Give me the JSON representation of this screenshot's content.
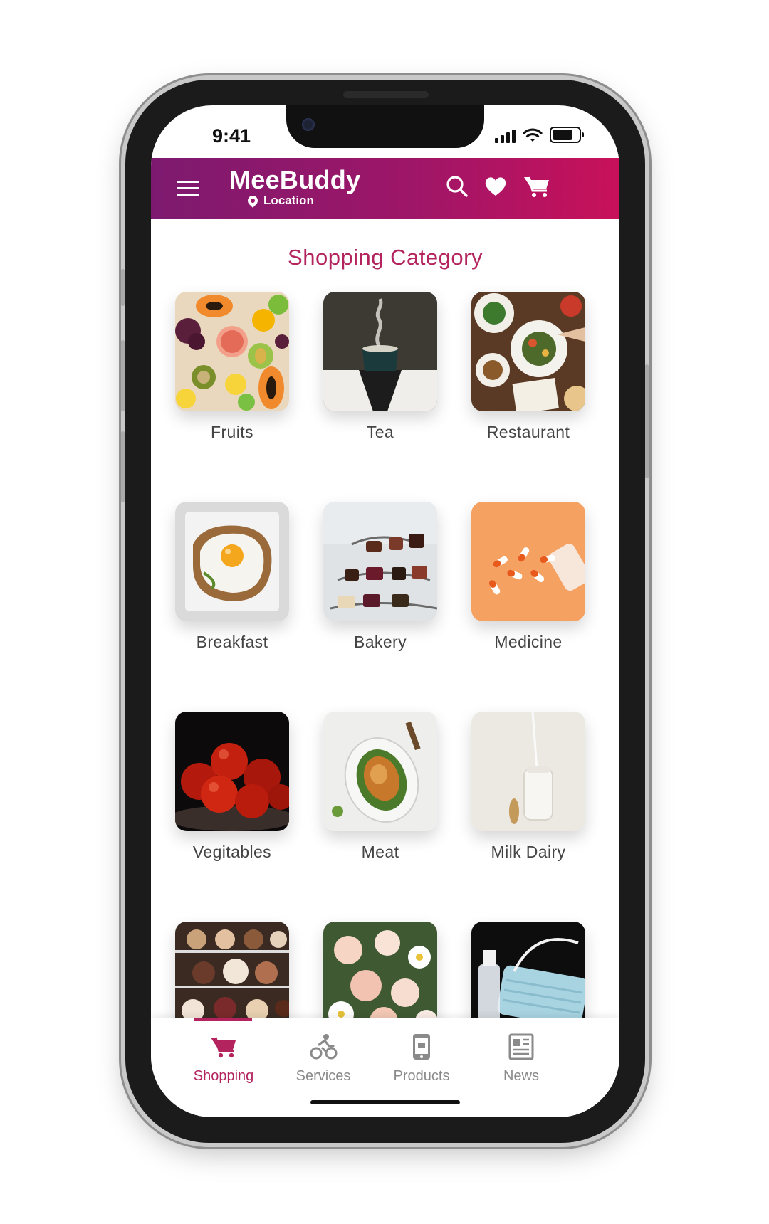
{
  "status": {
    "time": "9:41"
  },
  "appbar": {
    "title": "MeeBuddy",
    "location": "Location",
    "icons": [
      "menu-icon",
      "search-icon",
      "heart-icon",
      "cart-icon"
    ],
    "gradient": [
      "#7d1a6f",
      "#c8115a"
    ]
  },
  "section": {
    "title": "Shopping Category"
  },
  "categories": [
    {
      "label": "Fruits"
    },
    {
      "label": "Tea"
    },
    {
      "label": "Restaurant"
    },
    {
      "label": "Breakfast"
    },
    {
      "label": "Bakery"
    },
    {
      "label": "Medicine"
    },
    {
      "label": "Vegitables"
    },
    {
      "label": "Meat"
    },
    {
      "label": "Milk Dairy"
    }
  ],
  "bottom_nav": {
    "items": [
      {
        "label": "Shopping",
        "icon": "cart-icon",
        "active": true
      },
      {
        "label": "Services",
        "icon": "cyclist-icon",
        "active": false
      },
      {
        "label": "Products",
        "icon": "phone-icon",
        "active": false
      },
      {
        "label": "News",
        "icon": "newspaper-icon",
        "active": false
      }
    ]
  },
  "colors": {
    "accent": "#b3245e",
    "inactive": "#8a8a8a"
  }
}
